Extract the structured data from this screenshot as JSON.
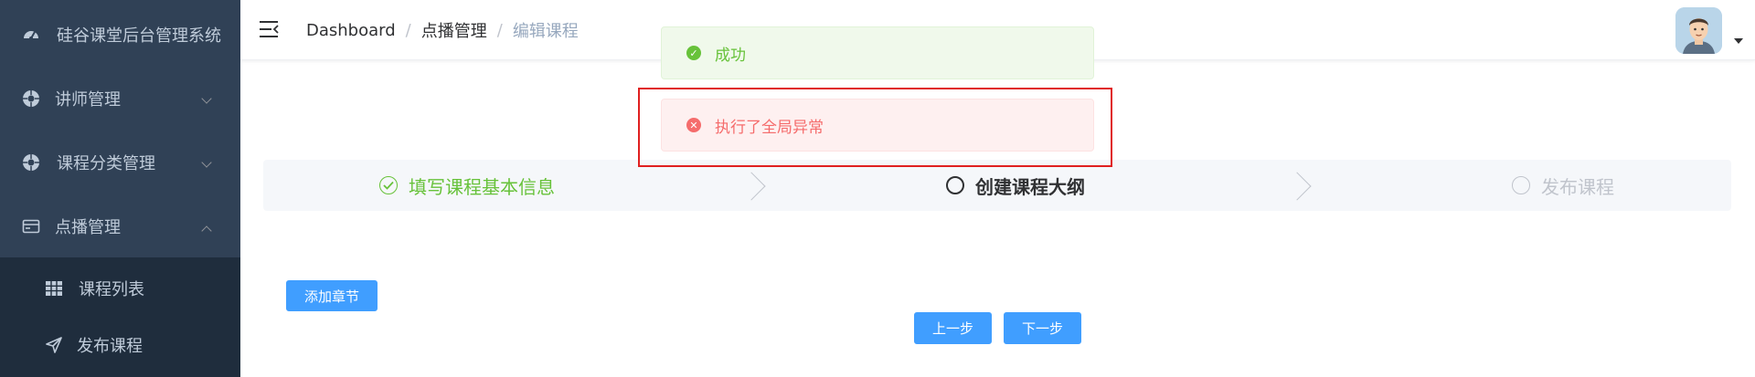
{
  "sidebar": {
    "title": "硅谷课堂后台管理系统",
    "items": [
      {
        "label": "讲师管理",
        "icon": "teacher-icon",
        "expanded": false
      },
      {
        "label": "课程分类管理",
        "icon": "category-icon",
        "expanded": false
      },
      {
        "label": "点播管理",
        "icon": "vod-icon",
        "expanded": true
      }
    ],
    "subitems": [
      {
        "label": "课程列表",
        "icon": "grid-icon"
      },
      {
        "label": "发布课程",
        "icon": "send-icon"
      }
    ]
  },
  "navbar": {
    "breadcrumb": [
      "Dashboard",
      "点播管理",
      "编辑课程"
    ],
    "separator": "/"
  },
  "steps": [
    {
      "label": "填写课程基本信息",
      "status": "finish"
    },
    {
      "label": "创建课程大纲",
      "status": "process"
    },
    {
      "label": "发布课程",
      "status": "wait"
    }
  ],
  "buttons": {
    "add_chapter": "添加章节",
    "prev": "上一步",
    "next": "下一步"
  },
  "messages": {
    "success": "成功",
    "error": "执行了全局异常"
  },
  "colors": {
    "sidebar_bg": "#304156",
    "submenu_bg": "#1f2d3d",
    "primary": "#409eff",
    "success": "#67c23a",
    "danger": "#f56c6c",
    "highlight": "#e02020"
  }
}
